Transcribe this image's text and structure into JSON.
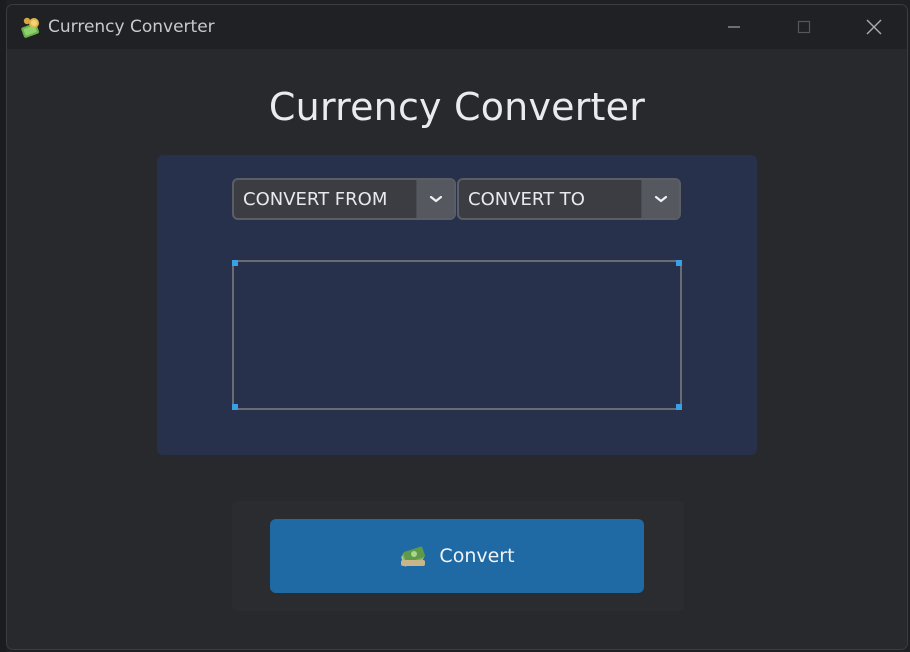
{
  "window": {
    "title": "Currency Converter",
    "icon": "money-bag-icon"
  },
  "controls": {
    "minimize_icon": "minimize-icon",
    "maximize_icon": "maximize-icon",
    "close_icon": "close-icon"
  },
  "main": {
    "heading": "Currency Converter",
    "from_select": {
      "selected": "CONVERT FROM",
      "icon": "chevron-down-icon"
    },
    "to_select": {
      "selected": "CONVERT TO",
      "icon": "chevron-down-icon"
    },
    "amount_input": {
      "value": "",
      "placeholder": ""
    },
    "convert_button": {
      "label": "Convert",
      "icon": "cash-icon"
    }
  },
  "colors": {
    "window_bg": "#27292d",
    "panel_bg": "#28314c",
    "accent": "#1f6aa5",
    "focus_corner": "#3aa0e6"
  }
}
